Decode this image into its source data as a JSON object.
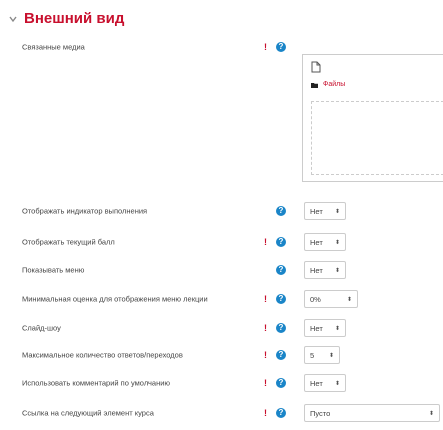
{
  "section": {
    "title": "Внешний вид"
  },
  "fields": {
    "media": {
      "label": "Связанные медиа",
      "filemanager_path": "Файлы"
    },
    "progressbar": {
      "label": "Отображать индикатор выполнения",
      "value": "Нет"
    },
    "ongoing": {
      "label": "Отображать текущий балл",
      "value": "Нет"
    },
    "displaymenu": {
      "label": "Показывать меню",
      "value": "Нет"
    },
    "mingrade": {
      "label": "Минимальная оценка для отображения меню лекции",
      "value": "0%"
    },
    "slideshow": {
      "label": "Слайд-шоу",
      "value": "Нет"
    },
    "maxanswers": {
      "label": "Максимальное количество ответов/переходов",
      "value": "5"
    },
    "feedback": {
      "label": "Использовать комментарий по умолчанию",
      "value": "Нет"
    },
    "activitylink": {
      "label": "Ссылка на следующий элемент курса",
      "value": "Пусто"
    }
  },
  "icons": {
    "collapse": "chevron-down-icon",
    "help": "question-circle-icon",
    "required": "exclamation-icon",
    "newfile": "new-file-icon",
    "folder": "folder-icon"
  },
  "colors": {
    "accent": "#c8102e",
    "help": "#1a85c8",
    "border": "#cccccc"
  }
}
